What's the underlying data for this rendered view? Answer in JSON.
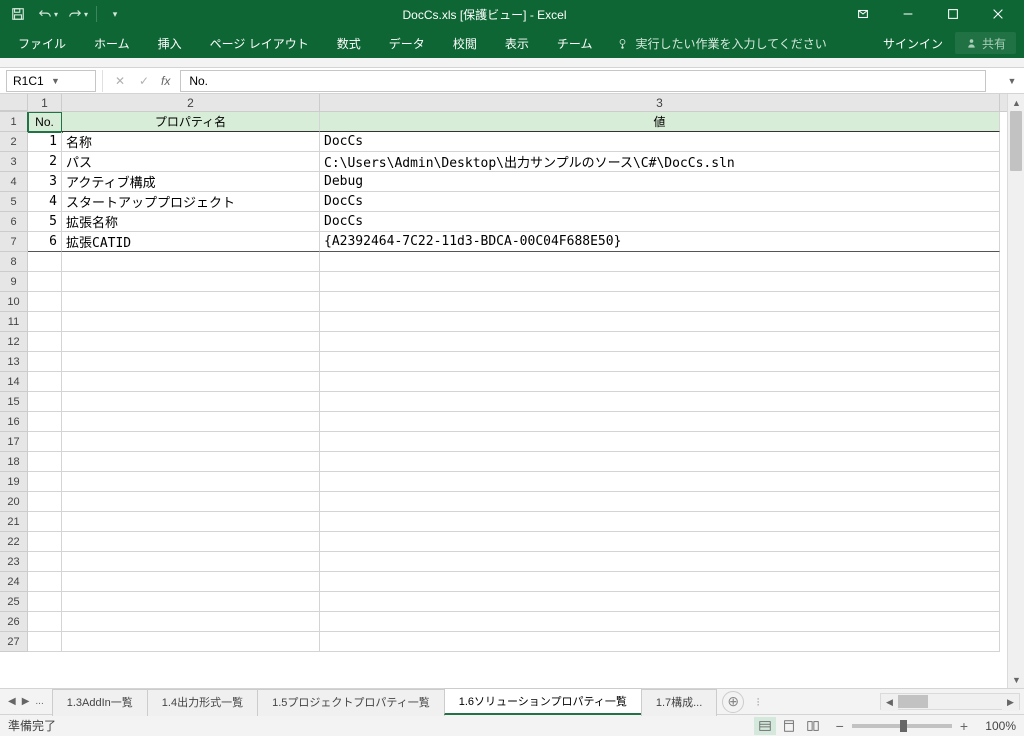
{
  "title": "DocCs.xls [保護ビュー] - Excel",
  "qat": {
    "save": "保存",
    "undo": "元に戻す",
    "redo": "やり直し"
  },
  "ribbon": {
    "tabs": [
      "ファイル",
      "ホーム",
      "挿入",
      "ページ レイアウト",
      "数式",
      "データ",
      "校閲",
      "表示",
      "チーム"
    ],
    "tell_me": "実行したい作業を入力してください",
    "signin": "サインイン",
    "share": "共有"
  },
  "name_box": "R1C1",
  "formula": "No.",
  "col_headers": [
    "1",
    "2",
    "3"
  ],
  "header_row": {
    "no": "No.",
    "prop": "プロパティ名",
    "val": "値"
  },
  "rows": [
    {
      "n": "1",
      "p": "名称",
      "v": "DocCs"
    },
    {
      "n": "2",
      "p": "パス",
      "v": "C:\\Users\\Admin\\Desktop\\出力サンプルのソース\\C#\\DocCs.sln"
    },
    {
      "n": "3",
      "p": "アクティブ構成",
      "v": "Debug"
    },
    {
      "n": "4",
      "p": "スタートアッププロジェクト",
      "v": "DocCs"
    },
    {
      "n": "5",
      "p": "拡張名称",
      "v": "DocCs"
    },
    {
      "n": "6",
      "p": "拡張CATID",
      "v": "{A2392464-7C22-11d3-BDCA-00C04F688E50}"
    }
  ],
  "empty_rows": [
    "8",
    "9",
    "10",
    "11",
    "12",
    "13",
    "14",
    "15",
    "16",
    "17",
    "18",
    "19",
    "20",
    "21",
    "22",
    "23",
    "24",
    "25",
    "26",
    "27"
  ],
  "sheet_tabs": {
    "ellipsis": "...",
    "tabs": [
      "1.3AddIn一覧",
      "1.4出力形式一覧",
      "1.5プロジェクトプロパティ一覧",
      "1.6ソリューションプロパティ一覧",
      "1.7構成..."
    ],
    "active_index": 3
  },
  "status": {
    "ready": "準備完了",
    "zoom": "100%"
  }
}
